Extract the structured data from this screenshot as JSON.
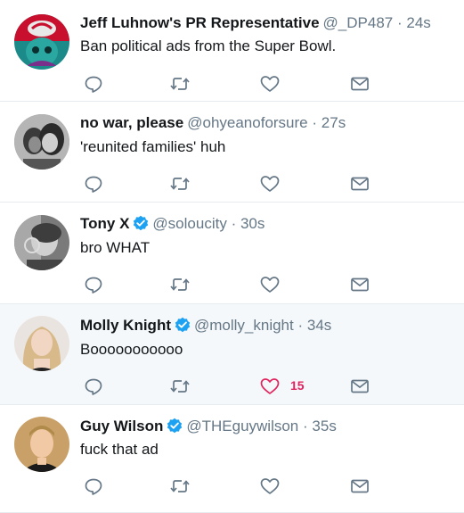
{
  "tweets": [
    {
      "name": "Jeff Luhnow's PR Representative",
      "handle": "@_DP487",
      "separator": "·",
      "time": "24s",
      "verified": false,
      "text": "Ban political ads from the Super Bowl.",
      "like_count": "",
      "liked": false
    },
    {
      "name": "no war, please",
      "handle": "@ohyeanoforsure",
      "separator": "·",
      "time": "27s",
      "verified": false,
      "text": "'reunited families' huh",
      "like_count": "",
      "liked": false
    },
    {
      "name": "Tony X",
      "handle": "@soloucity",
      "separator": "·",
      "time": "30s",
      "verified": true,
      "text": "bro WHAT",
      "like_count": "",
      "liked": false
    },
    {
      "name": "Molly Knight",
      "handle": "@molly_knight",
      "separator": "·",
      "time": "34s",
      "verified": true,
      "text": "Booooooooooo",
      "like_count": "15",
      "liked": true
    },
    {
      "name": "Guy Wilson",
      "handle": "@THEguywilson",
      "separator": "·",
      "time": "35s",
      "verified": true,
      "text": "fuck that ad",
      "like_count": "",
      "liked": false
    }
  ],
  "colors": {
    "text": "#14171a",
    "muted": "#657786",
    "verified": "#1da1f2",
    "like_active": "#e0245e",
    "highlight_bg": "#f5f8fa",
    "divider": "#e6ecf0"
  },
  "icons": {
    "reply": "reply-icon",
    "retweet": "retweet-icon",
    "like": "heart-icon",
    "dm": "envelope-icon",
    "verified": "verified-badge-icon"
  }
}
